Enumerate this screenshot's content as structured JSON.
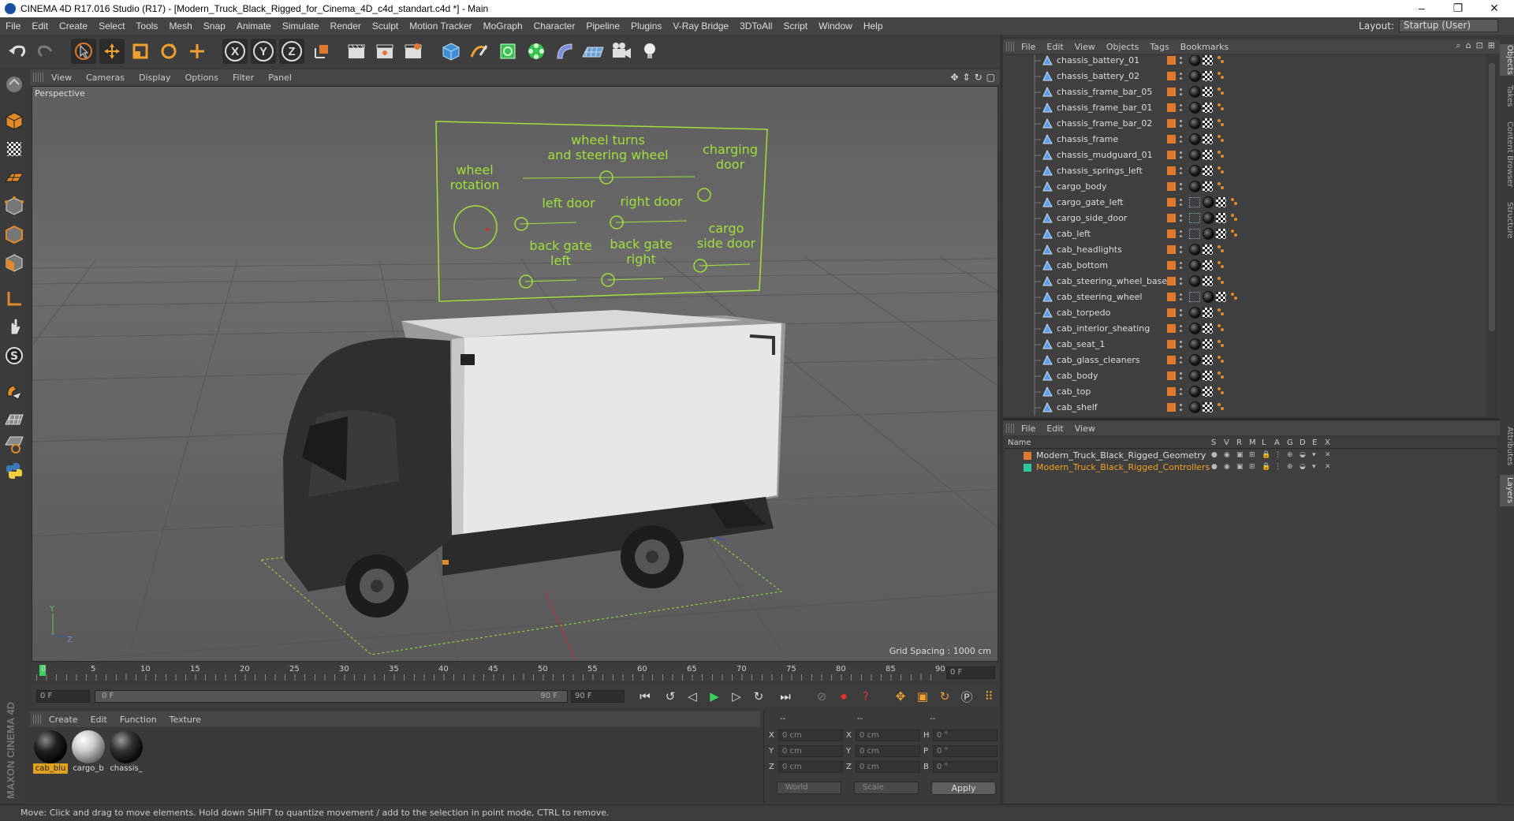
{
  "window": {
    "title": "CINEMA 4D R17.016 Studio (R17) - [Modern_Truck_Black_Rigged_for_Cinema_4D_c4d_standart.c4d *] - Main",
    "controls": [
      "–",
      "❐",
      "✕"
    ]
  },
  "menubar": {
    "items": [
      "File",
      "Edit",
      "Create",
      "Select",
      "Tools",
      "Mesh",
      "Snap",
      "Animate",
      "Simulate",
      "Render",
      "Sculpt",
      "Motion Tracker",
      "MoGraph",
      "Character",
      "Pipeline",
      "Plugins",
      "V-Ray Bridge",
      "3DToAll",
      "Script",
      "Window",
      "Help"
    ],
    "layout_label": "Layout:",
    "layout_value": "Startup (User)"
  },
  "toolbar": {
    "axis_x": "X",
    "axis_y": "Y",
    "axis_z": "Z"
  },
  "viewport": {
    "menu": [
      "View",
      "Cameras",
      "Display",
      "Options",
      "Filter",
      "Panel"
    ],
    "label": "Perspective",
    "grid_spacing": "Grid Spacing : 1000 cm",
    "hud": {
      "wheel_rotation": "wheel\nrotation",
      "wheel_turns": "wheel turns\nand steering wheel",
      "charging_door": "charging\ndoor",
      "left_door": "left door",
      "right_door": "right door",
      "back_gate_left": "back gate\nleft",
      "back_gate_right": "back gate\nright",
      "cargo_side_door": "cargo\nside door"
    }
  },
  "timeline": {
    "ticks": [
      "0",
      "5",
      "10",
      "15",
      "20",
      "25",
      "30",
      "35",
      "40",
      "45",
      "50",
      "55",
      "60",
      "65",
      "70",
      "75",
      "80",
      "85",
      "90"
    ],
    "current_frame": "0 F",
    "start_field": "0 F",
    "range_start": "0 F",
    "range_end": "90 F",
    "end_field": "90 F"
  },
  "material_manager": {
    "menu": [
      "Create",
      "Edit",
      "Function",
      "Texture"
    ],
    "materials": [
      {
        "label": "cab_blu"
      },
      {
        "label": "cargo_b"
      },
      {
        "label": "chassis_"
      }
    ]
  },
  "coordinates": {
    "headers": [
      "--",
      "--",
      "--"
    ],
    "rows": [
      {
        "a": "X",
        "av": "0 cm",
        "b": "X",
        "bv": "0 cm",
        "c": "H",
        "cv": "0 °"
      },
      {
        "a": "Y",
        "av": "0 cm",
        "b": "Y",
        "bv": "0 cm",
        "c": "P",
        "cv": "0 °"
      },
      {
        "a": "Z",
        "av": "0 cm",
        "b": "Z",
        "bv": "0 cm",
        "c": "B",
        "cv": "0 °"
      }
    ],
    "mode_world": "World",
    "mode_scale": "Scale",
    "apply": "Apply"
  },
  "object_manager": {
    "menu": [
      "File",
      "Edit",
      "View",
      "Objects",
      "Tags",
      "Bookmarks"
    ],
    "objects": [
      {
        "name": "chassis_battery_01"
      },
      {
        "name": "chassis_battery_02"
      },
      {
        "name": "chassis_frame_bar_05"
      },
      {
        "name": "chassis_frame_bar_01"
      },
      {
        "name": "chassis_frame_bar_02"
      },
      {
        "name": "chassis_frame"
      },
      {
        "name": "chassis_mudguard_01"
      },
      {
        "name": "chassis_springs_left"
      },
      {
        "name": "cargo_body"
      },
      {
        "name": "cargo_gate_left"
      },
      {
        "name": "cargo_side_door"
      },
      {
        "name": "cab_left"
      },
      {
        "name": "cab_headlights"
      },
      {
        "name": "cab_bottom"
      },
      {
        "name": "cab_steering_wheel_base"
      },
      {
        "name": "cab_steering_wheel"
      },
      {
        "name": "cab_torpedo"
      },
      {
        "name": "cab_interior_sheating"
      },
      {
        "name": "cab_seat_1"
      },
      {
        "name": "cab_glass_cleaners"
      },
      {
        "name": "cab_body"
      },
      {
        "name": "cab_top"
      },
      {
        "name": "cab_shelf"
      }
    ]
  },
  "layer_manager": {
    "menu": [
      "File",
      "Edit",
      "View"
    ],
    "columns": [
      "Name",
      "S",
      "V",
      "R",
      "M",
      "L",
      "A",
      "G",
      "D",
      "E",
      "X"
    ],
    "layers": [
      {
        "name": "Modern_Truck_Black_Rigged_Geometry",
        "color": "#e0782e",
        "text_color": "#dddddd"
      },
      {
        "name": "Modern_Truck_Black_Rigged_Controllers",
        "color": "#2ec4a0",
        "text_color": "#f0a020"
      }
    ]
  },
  "right_tabs": [
    "Objects",
    "Takes",
    "Content Browser",
    "Structure",
    "Attributes",
    "Layers"
  ],
  "status": "Move: Click and drag to move elements. Hold down SHIFT to quantize movement / add to the selection in point mode, CTRL to remove.",
  "brand": "MAXON CINEMA 4D",
  "colors": {
    "hud_green": "#9fe03a",
    "accent_orange": "#e0782e"
  }
}
